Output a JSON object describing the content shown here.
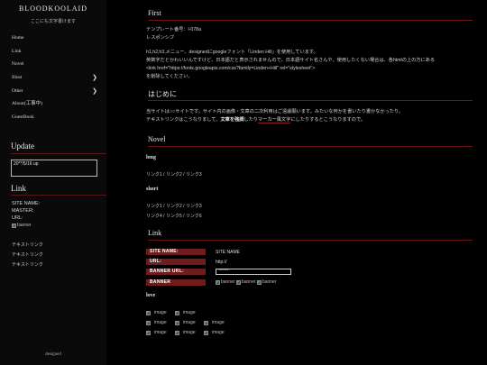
{
  "sidebar": {
    "site_title": "BLOODKOOLAID",
    "subtitle": "ここにも文字書けます",
    "nav": [
      {
        "label": "Home",
        "submenu": false
      },
      {
        "label": "Link",
        "submenu": false
      },
      {
        "label": "Novel",
        "submenu": false
      },
      {
        "label": "Illust",
        "submenu": true
      },
      {
        "label": "Other",
        "submenu": true
      },
      {
        "label": "About(工事中)",
        "submenu": false
      },
      {
        "label": "GuestBook",
        "submenu": false
      }
    ],
    "update": {
      "heading": "Update",
      "entry": "20**/5/16 up"
    },
    "link": {
      "heading": "Link",
      "site_name": "SITE NAME:",
      "master": "MASTER:",
      "url": "URL:",
      "banner_alt": "banner",
      "text_links": [
        "テキストリンク",
        "テキストリンク",
        "テキストリンク"
      ]
    },
    "designed": "designed"
  },
  "main": {
    "first": {
      "heading": "First",
      "lines": [
        "テンプレート番号：l-078a",
        "レスポンシブ",
        "",
        "h1,h2,h3,メニュー、designedにgoogleフォント「Linden Hill」を使用しています。",
        "英数字だとかわいいんですけど、日本語だと表示されませんので、日本語サイト名さんや、使用したくない場合は、各htmlの上の方にある",
        "<link href=\"https://fonts.googleapis.com/css?family=Linden+Hill\" rel=\"stylesheet\">",
        "を削除してください。"
      ]
    },
    "intro": {
      "heading": "はじめに",
      "text_before": "当サイトは○○サイトです。サイト内の画像・文章の二次利用はご遠慮願います。みたいな何かを書いたり書かなかったり。",
      "text_line2_a": "テキストリンク",
      "text_line2_b": "はこうなりまして、",
      "bold": "文章を強調",
      "text_line2_c": "したり",
      "marker": "マーカー風文字",
      "text_line2_d": "にしたりするとこうなりますので。"
    },
    "novel": {
      "heading": "Novel",
      "long": {
        "title": "long",
        "links": [
          "リンク1 / リンク2 / リンク3"
        ]
      },
      "short": {
        "title": "short",
        "links": [
          "リンク1 / リンク2 / リンク3",
          "リンク4 / リンク5 / リンク6"
        ]
      }
    },
    "link": {
      "heading": "Link",
      "fields": [
        {
          "label": "SITE NAME:",
          "value": "SITE NAME"
        },
        {
          "label": "URL:",
          "value": "http://"
        },
        {
          "label": "BANNER URL:",
          "value": "******"
        },
        {
          "label": "BANNER",
          "value": ""
        }
      ],
      "banner_alts": [
        "banner",
        "banner",
        "banner"
      ],
      "love": {
        "title": "love",
        "rows": [
          [
            "image",
            "image"
          ],
          [
            "image",
            "image",
            "image"
          ],
          [
            "image",
            "image",
            "image"
          ]
        ]
      }
    }
  }
}
